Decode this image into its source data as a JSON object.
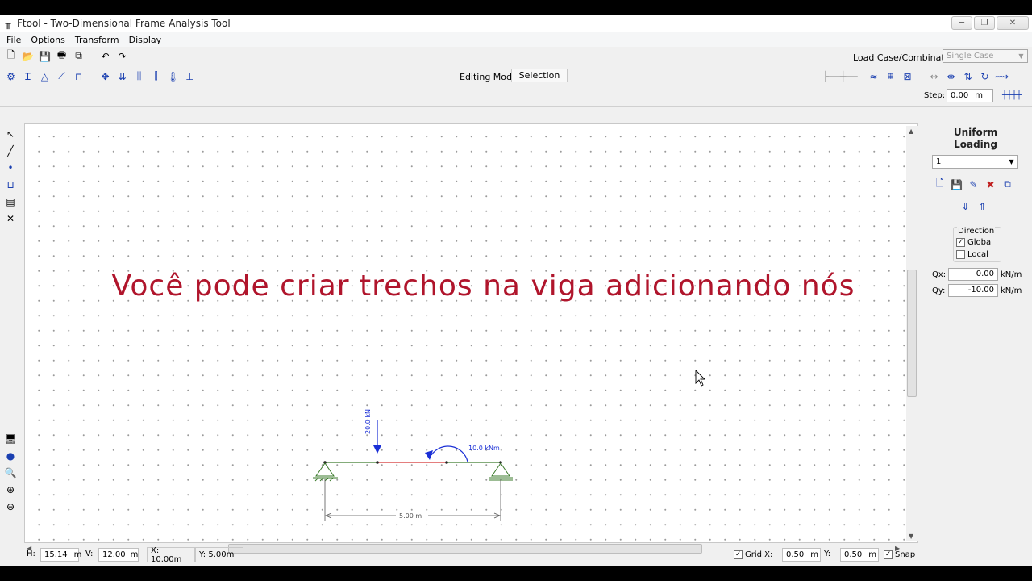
{
  "window": {
    "title": "Ftool - Two-Dimensional Frame Analysis Tool",
    "controls": [
      "─",
      "❐",
      "✕"
    ]
  },
  "menu": [
    "File",
    "Options",
    "Transform",
    "Display"
  ],
  "toolbar": {
    "load_case_label": "Load Case/Combination:",
    "load_case_value": "Single Case",
    "editing_mode_label": "Editing Mode:",
    "editing_mode_value": "Selection",
    "step_label": "Step:",
    "step_value": "0.00",
    "step_unit": "m"
  },
  "caption": "Você pode criar trechos na viga adicionando nós",
  "model": {
    "point_load_label": "20.0 kN",
    "moment_label": "10.0 kNm",
    "span_label": "5.00 m"
  },
  "panel": {
    "title_line1": "Uniform",
    "title_line2": "Loading",
    "selected_load": "1",
    "direction_label": "Direction",
    "global_label": "Global",
    "global_checked": true,
    "local_label": "Local",
    "local_checked": false,
    "qx_label": "Qx:",
    "qx_value": "0.00",
    "qx_unit": "kN/m",
    "qy_label": "Qy:",
    "qy_value": "-10.00",
    "qy_unit": "kN/m"
  },
  "status": {
    "h_label": "H:",
    "h_value": "15.14",
    "h_unit": "m",
    "v_label": "V:",
    "v_value": "12.00",
    "v_unit": "m",
    "x_coord": "X: 10.00m",
    "y_coord": "Y: 5.00m",
    "grid_label": "Grid X:",
    "grid_x": "0.50",
    "grid_x_unit": "m",
    "grid_y_label": "Y:",
    "grid_y": "0.50",
    "grid_y_unit": "m",
    "snap_label": "Snap"
  },
  "colors": {
    "caption": "#b0152c",
    "load": "#1a2fd6",
    "beam": "#3a7a2a",
    "beam_segment": "#d43030"
  }
}
